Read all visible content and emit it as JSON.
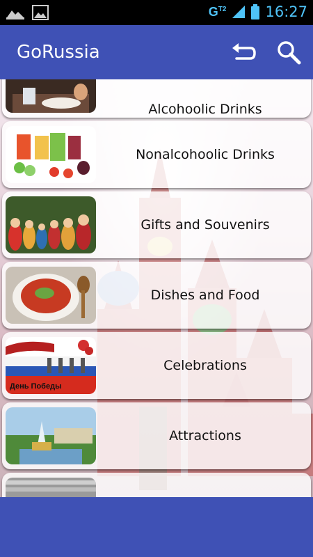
{
  "status_bar": {
    "time": "16:27",
    "network": "G",
    "network_sub": "T2"
  },
  "app_bar": {
    "title": "GoRussia"
  },
  "categories": [
    {
      "label": "Alcohoolic Drinks"
    },
    {
      "label": "Nonalcohoolic Drinks"
    },
    {
      "label": "Gifts and Souvenirs"
    },
    {
      "label": "Dishes and Food"
    },
    {
      "label": "Celebrations",
      "thumbnail_text": "День Победы"
    },
    {
      "label": "Attractions"
    },
    {
      "label": ""
    }
  ]
}
